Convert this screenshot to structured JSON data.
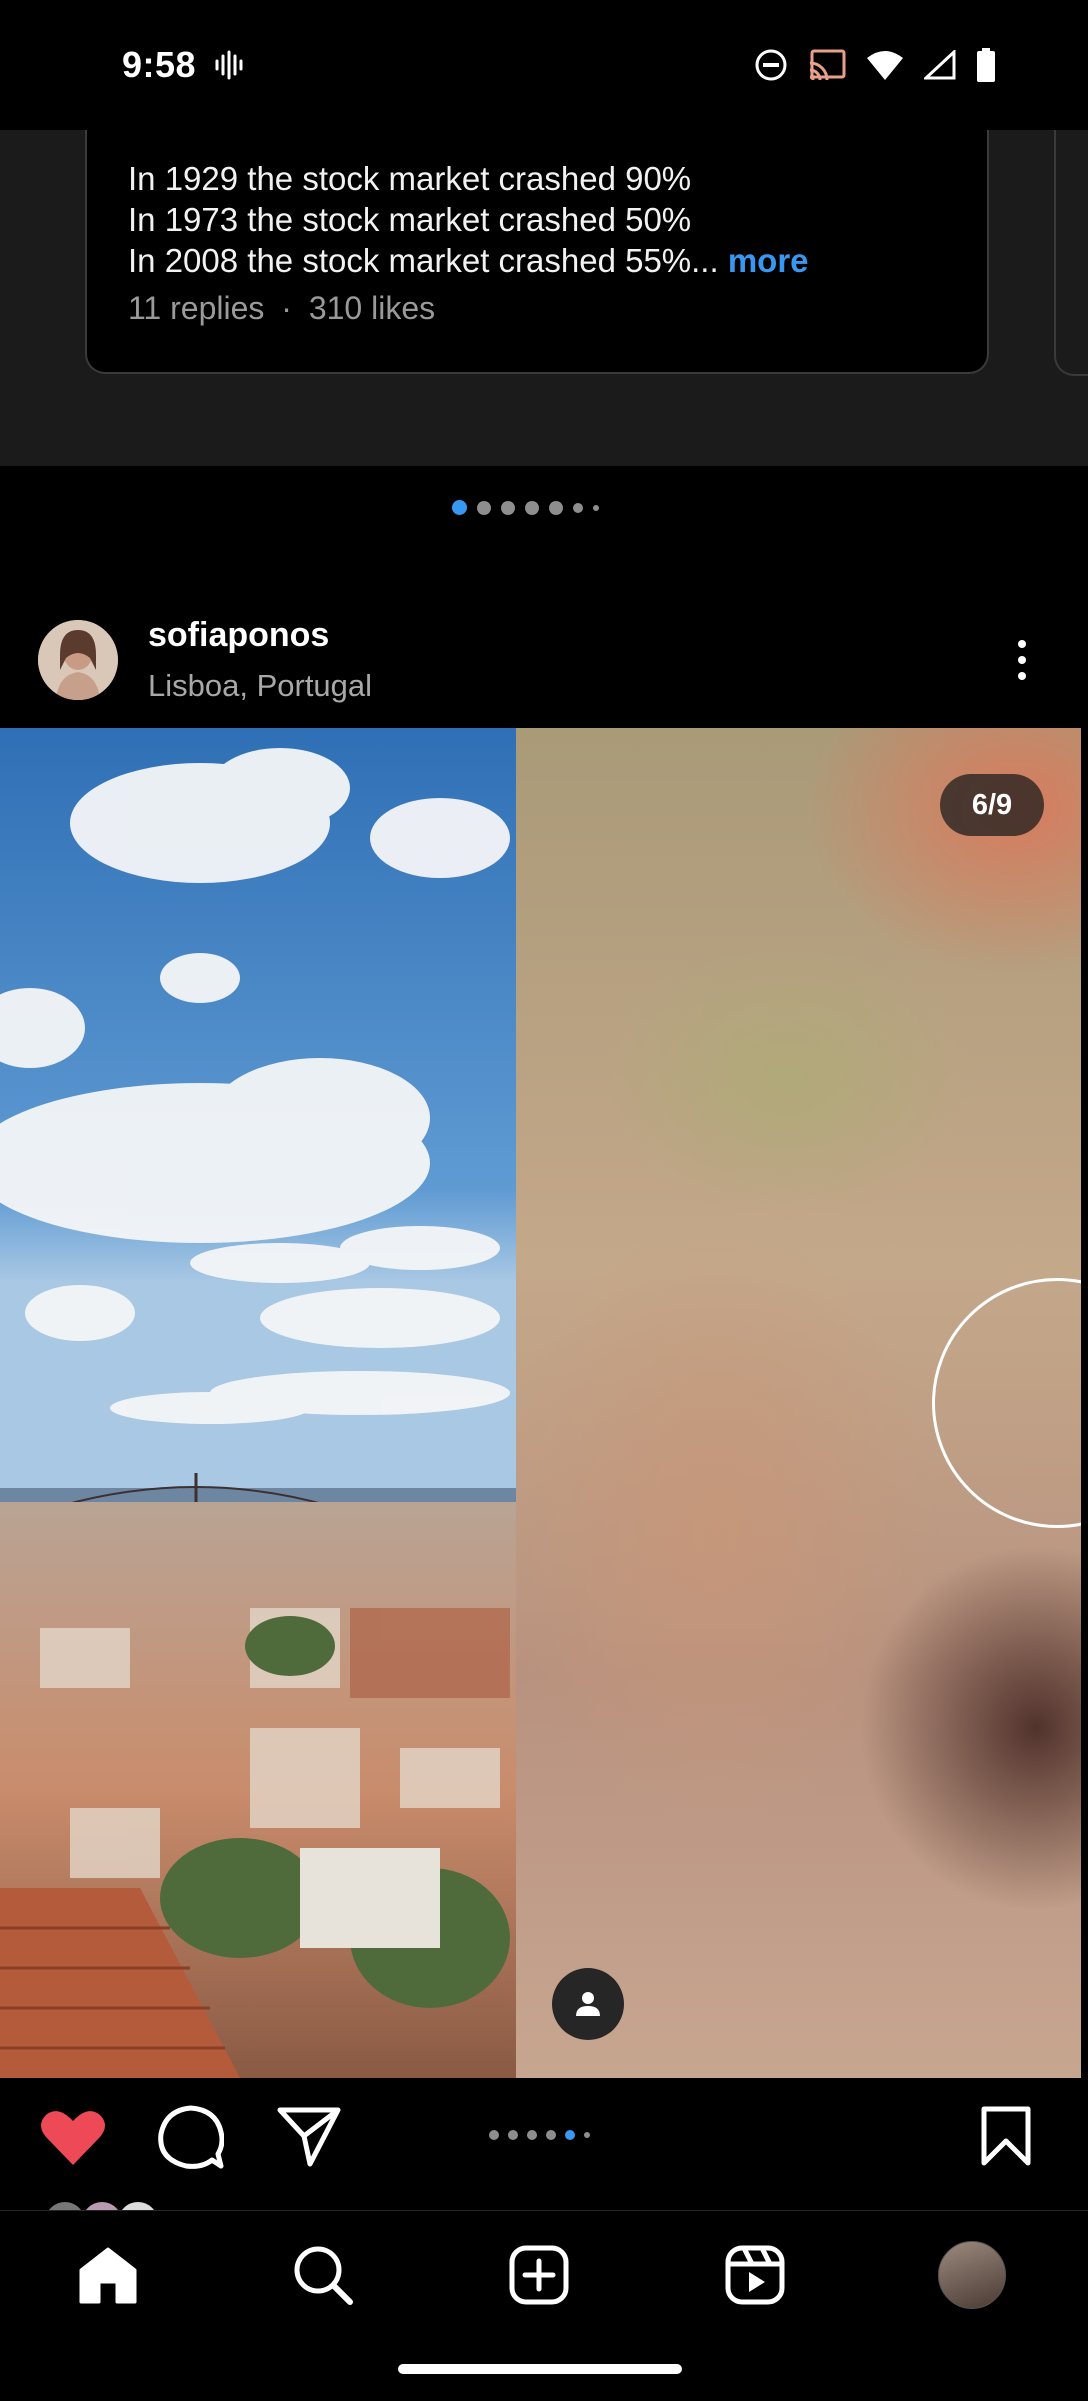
{
  "status_bar": {
    "time": "9:58"
  },
  "threads_card": {
    "lines": [
      "In 1929 the stock market crashed 90%",
      "In 1973 the stock market crashed 50%",
      "In 2008 the stock market crashed 55%..."
    ],
    "more_label": "more",
    "replies": "11 replies",
    "separator": "·",
    "likes": "310 likes",
    "carousel_count": 7,
    "carousel_active": 0
  },
  "post": {
    "username": "sofiaponos",
    "location": "Lisboa, Portugal",
    "counter": "6/9",
    "carousel_count": 6,
    "carousel_active": 4,
    "liked": true
  },
  "colors": {
    "accent": "#3897f0",
    "like_red": "#ed4956",
    "background": "#000000"
  },
  "nav": {
    "items": [
      "home-icon",
      "search-icon",
      "create-icon",
      "reels-icon",
      "profile-avatar"
    ]
  }
}
